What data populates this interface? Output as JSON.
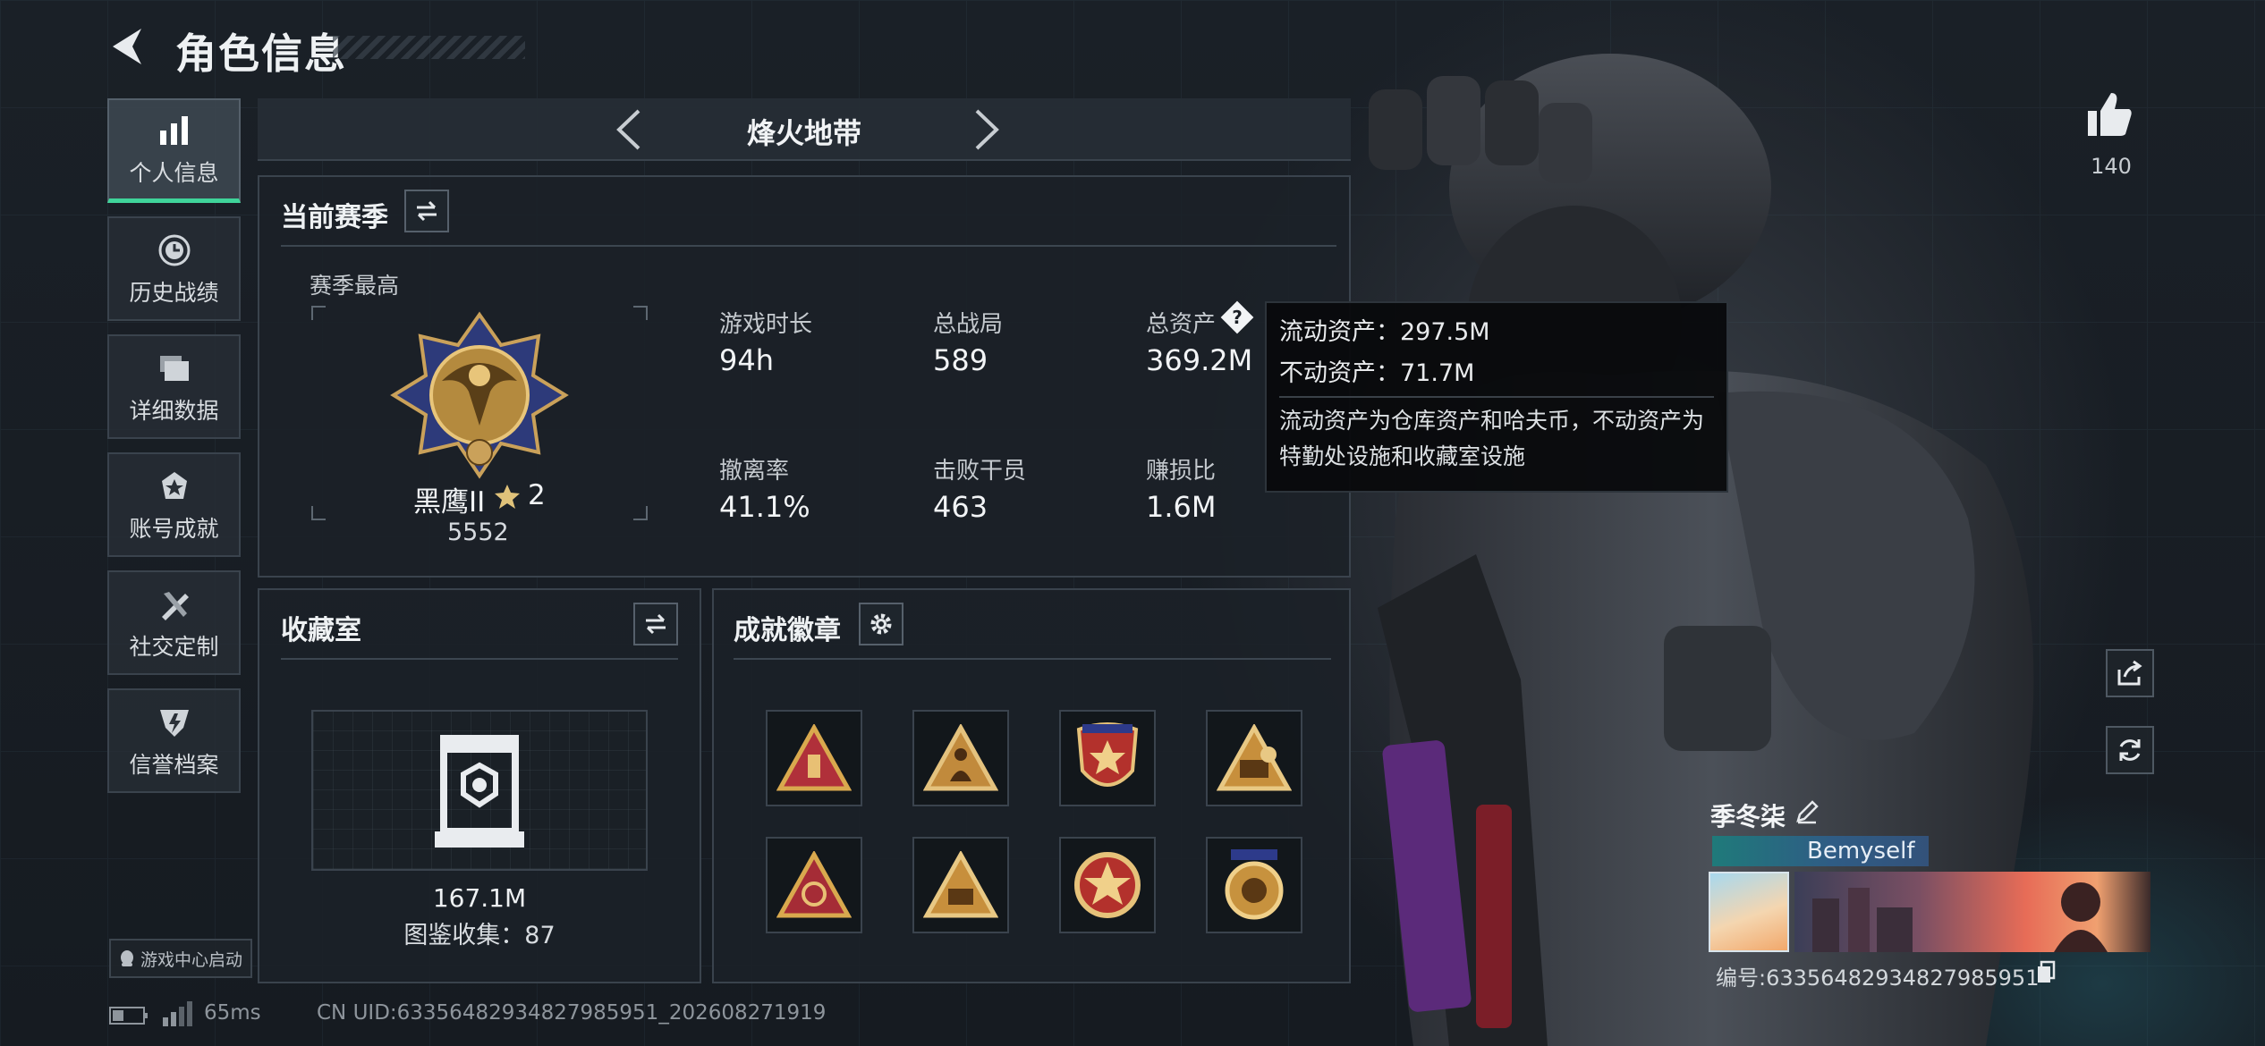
{
  "header": {
    "title": "角色信息"
  },
  "nav": [
    {
      "label": "个人信息",
      "icon": "bar-chart-icon",
      "active": true
    },
    {
      "label": "历史战绩",
      "icon": "clock-icon",
      "active": false
    },
    {
      "label": "详细数据",
      "icon": "folder-icon",
      "active": false
    },
    {
      "label": "账号成就",
      "icon": "achievement-icon",
      "active": false
    },
    {
      "label": "社交定制",
      "icon": "tools-icon",
      "active": false
    },
    {
      "label": "信誉档案",
      "icon": "shield-icon",
      "active": false
    }
  ],
  "mode_selector": {
    "label": "烽火地带"
  },
  "season": {
    "title": "当前赛季",
    "best_label": "赛季最高",
    "rank_name": "黑鹰II",
    "rank_stars": "2",
    "rank_score": "5552",
    "stats": [
      {
        "label": "游戏时长",
        "value": "94h"
      },
      {
        "label": "总战局",
        "value": "589"
      },
      {
        "label": "总资产",
        "value": "369.2M"
      },
      {
        "label": "撤离率",
        "value": "41.1%"
      },
      {
        "label": "击败干员",
        "value": "463"
      },
      {
        "label": "赚损比",
        "value": "1.6M"
      }
    ]
  },
  "tooltip": {
    "liquid": "流动资产：297.5M",
    "fixed": "不动资产：71.7M",
    "description": "流动资产为仓库资产和哈夫币，不动资产为特勤处设施和收藏室设施"
  },
  "collection": {
    "title": "收藏室",
    "value": "167.1M",
    "count_label": "图鉴收集：87"
  },
  "achievements": {
    "title": "成就徽章",
    "badges": [
      "badge-triangle-bottle",
      "badge-triangle-figure",
      "badge-star-emblem",
      "badge-triangle-56",
      "badge-triangle-flask",
      "badge-triangle-55",
      "badge-round-star",
      "badge-round-emblem"
    ]
  },
  "profile": {
    "likes": "140",
    "name": "季冬柒",
    "tag": "Bemyself",
    "id_label": "编号:63356482934827985951"
  },
  "footer": {
    "game_center": "游戏中心启动",
    "ping": "65ms",
    "uid": "CN UID:63356482934827985951_202608271919"
  },
  "colors": {
    "accent": "#3fd49a",
    "gold": "#c9a04a"
  }
}
